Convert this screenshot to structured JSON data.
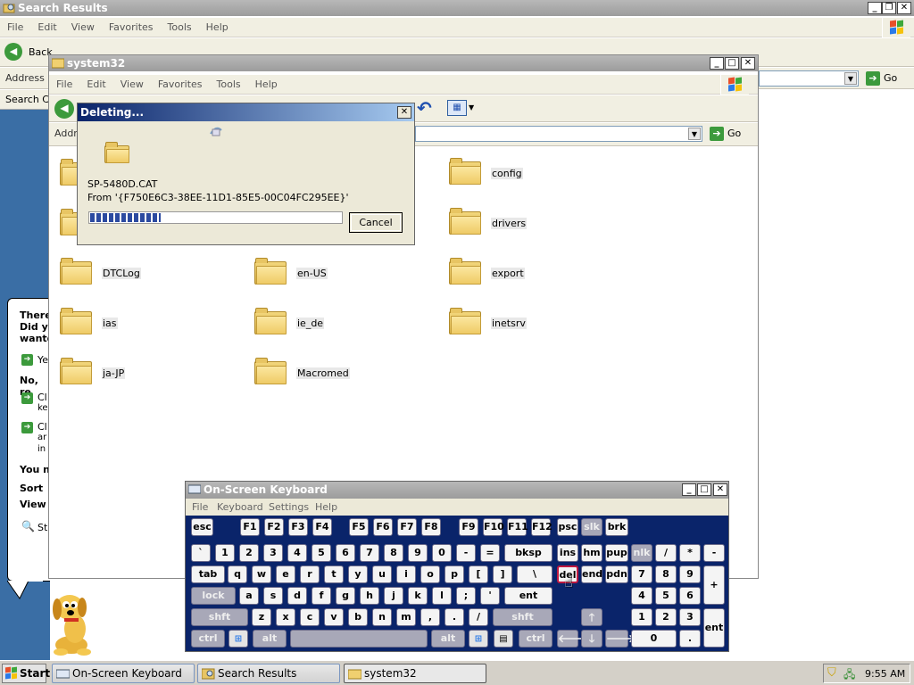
{
  "search_window": {
    "title": "Search Results",
    "menu": [
      "File",
      "Edit",
      "View",
      "Favorites",
      "Tools",
      "Help"
    ],
    "back_label": "Back",
    "address_label": "Address",
    "go_label": "Go",
    "search_companion_label": "Search C",
    "assistant_text": [
      "There",
      "Did y",
      "wante",
      "Ye",
      "No, re",
      "Cl",
      "ke",
      "Cl",
      "ar",
      "in",
      "You n",
      "Sort",
      "View",
      "St"
    ]
  },
  "explorer_window": {
    "title": "system32",
    "menu": [
      "File",
      "Edit",
      "View",
      "Favorites",
      "Tools",
      "Help"
    ],
    "address_label": "Addr",
    "go_label": "Go",
    "folders": [
      "config",
      "drivers",
      "DTCLog",
      "en-US",
      "export",
      "ias",
      "ie_de",
      "inetsrv",
      "ja-JP",
      "Macromed"
    ]
  },
  "delete_dialog": {
    "title": "Deleting...",
    "file_name": "SP-5480D.CAT",
    "from_text": "From '{F750E6C3-38EE-11D1-85E5-00C04FC295EE}'",
    "cancel_label": "Cancel",
    "progress_fraction": 0.28
  },
  "osk": {
    "title": "On-Screen Keyboard",
    "menu": [
      "File",
      "Keyboard",
      "Settings",
      "Help"
    ],
    "keys": {
      "esc": "esc",
      "f1": "F1",
      "f2": "F2",
      "f3": "F3",
      "f4": "F4",
      "f5": "F5",
      "f6": "F6",
      "f7": "F7",
      "f8": "F8",
      "f9": "F9",
      "f10": "F10",
      "f11": "F11",
      "f12": "F12",
      "psc": "psc",
      "slk": "slk",
      "brk": "brk",
      "grave": "`",
      "d1": "1",
      "d2": "2",
      "d3": "3",
      "d4": "4",
      "d5": "5",
      "d6": "6",
      "d7": "7",
      "d8": "8",
      "d9": "9",
      "d0": "0",
      "minus": "-",
      "equals": "=",
      "bksp": "bksp",
      "ins": "ins",
      "hm": "hm",
      "pup": "pup",
      "nlk": "nlk",
      "slash": "/",
      "star": "*",
      "nminus": "-",
      "tab": "tab",
      "q": "q",
      "w": "w",
      "e": "e",
      "r": "r",
      "t": "t",
      "y": "y",
      "u": "u",
      "i": "i",
      "o": "o",
      "p": "p",
      "lbr": "[",
      "rbr": "]",
      "bslash": "\\",
      "del": "del",
      "end": "end",
      "pdn": "pdn",
      "n7": "7",
      "n8": "8",
      "n9": "9",
      "plus": "+",
      "lock": "lock",
      "a": "a",
      "s": "s",
      "d": "d",
      "f": "f",
      "g": "g",
      "h": "h",
      "j": "j",
      "k": "k",
      "l": "l",
      "semi": ";",
      "quote": "'",
      "ent": "ent",
      "n4": "4",
      "n5": "5",
      "n6": "6",
      "lshft": "shft",
      "z": "z",
      "x": "x",
      "c": "c",
      "v": "v",
      "b": "b",
      "n": "n",
      "m": "m",
      "comma": ",",
      "period": ".",
      "fslash": "/",
      "rshft": "shft",
      "up": "🡑",
      "n1": "1",
      "n2": "2",
      "n3": "3",
      "nent": "ent",
      "lctrl": "ctrl",
      "lalt": "alt",
      "ralt": "alt",
      "rctrl": "ctrl",
      "left": "🡐",
      "down": "🡓",
      "right": "🡒",
      "n0": "0",
      "ndot": "."
    }
  },
  "taskbar": {
    "start_label": "Start",
    "buttons": [
      "On-Screen Keyboard",
      "Search Results",
      "system32"
    ],
    "clock": "9:55 AM"
  },
  "colors": {
    "keyboard_bg": "#0a246a",
    "taskbar": "#d4d0c8",
    "desktop": "#3a6ea5",
    "highlight_key_border": "#c01840"
  }
}
